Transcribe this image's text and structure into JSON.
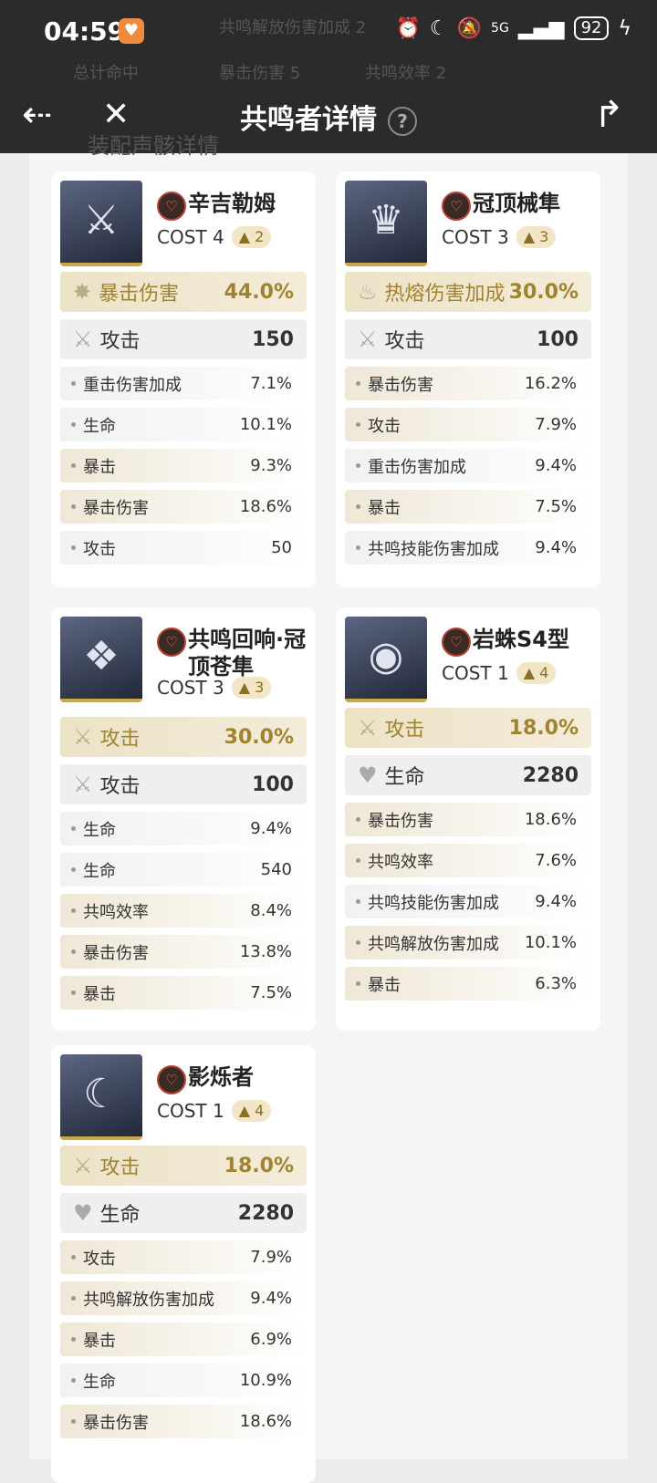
{
  "status": {
    "time": "04:59",
    "battery": "92",
    "network": "5G"
  },
  "nav": {
    "title": "共鸣者详情",
    "help": "?"
  },
  "background": {
    "line1": "共鸣解放伤害加成 2",
    "line2_a": "总计命中",
    "line2_b": "暴击伤害 5",
    "line2_c": "共鸣效率 2",
    "line3": "装配声骸详情"
  },
  "cards": [
    {
      "name": "辛吉勒姆",
      "cost": "COST 4",
      "tune": "2",
      "portrait_icon": "⚔",
      "main": {
        "label": "暴击伤害",
        "value": "44.0%",
        "icon": "✸"
      },
      "flat": {
        "label": "攻击",
        "value": "150",
        "icon": "⚔"
      },
      "subs": [
        {
          "label": "重击伤害加成",
          "value": "7.1%",
          "tone": "gray"
        },
        {
          "label": "生命",
          "value": "10.1%",
          "tone": "gray"
        },
        {
          "label": "暴击",
          "value": "9.3%",
          "tone": "gold"
        },
        {
          "label": "暴击伤害",
          "value": "18.6%",
          "tone": "gold"
        },
        {
          "label": "攻击",
          "value": "50",
          "tone": "gray"
        }
      ]
    },
    {
      "name": "冠顶械隼",
      "cost": "COST 3",
      "tune": "3",
      "portrait_icon": "♛",
      "main": {
        "label": "热熔伤害加成",
        "value": "30.0%",
        "icon": "♨"
      },
      "flat": {
        "label": "攻击",
        "value": "100",
        "icon": "⚔"
      },
      "subs": [
        {
          "label": "暴击伤害",
          "value": "16.2%",
          "tone": "gold"
        },
        {
          "label": "攻击",
          "value": "7.9%",
          "tone": "gold"
        },
        {
          "label": "重击伤害加成",
          "value": "9.4%",
          "tone": "gray"
        },
        {
          "label": "暴击",
          "value": "7.5%",
          "tone": "gold"
        },
        {
          "label": "共鸣技能伤害加成",
          "value": "9.4%",
          "tone": "gray"
        }
      ]
    },
    {
      "name": "共鸣回响·冠顶苍隼",
      "cost": "COST 3",
      "tune": "3",
      "portrait_icon": "❖",
      "main": {
        "label": "攻击",
        "value": "30.0%",
        "icon": "⚔"
      },
      "flat": {
        "label": "攻击",
        "value": "100",
        "icon": "⚔"
      },
      "subs": [
        {
          "label": "生命",
          "value": "9.4%",
          "tone": "gray"
        },
        {
          "label": "生命",
          "value": "540",
          "tone": "gray"
        },
        {
          "label": "共鸣效率",
          "value": "8.4%",
          "tone": "gold"
        },
        {
          "label": "暴击伤害",
          "value": "13.8%",
          "tone": "gold"
        },
        {
          "label": "暴击",
          "value": "7.5%",
          "tone": "gold"
        }
      ]
    },
    {
      "name": "岩蛛S4型",
      "cost": "COST 1",
      "tune": "4",
      "portrait_icon": "◉",
      "main": {
        "label": "攻击",
        "value": "18.0%",
        "icon": "⚔"
      },
      "flat": {
        "label": "生命",
        "value": "2280",
        "icon": "♥"
      },
      "subs": [
        {
          "label": "暴击伤害",
          "value": "18.6%",
          "tone": "gold"
        },
        {
          "label": "共鸣效率",
          "value": "7.6%",
          "tone": "gold"
        },
        {
          "label": "共鸣技能伤害加成",
          "value": "9.4%",
          "tone": "gray"
        },
        {
          "label": "共鸣解放伤害加成",
          "value": "10.1%",
          "tone": "gold"
        },
        {
          "label": "暴击",
          "value": "6.3%",
          "tone": "gold"
        }
      ]
    },
    {
      "name": "影烁者",
      "cost": "COST 1",
      "tune": "4",
      "portrait_icon": "☾",
      "main": {
        "label": "攻击",
        "value": "18.0%",
        "icon": "⚔"
      },
      "flat": {
        "label": "生命",
        "value": "2280",
        "icon": "♥"
      },
      "subs": [
        {
          "label": "攻击",
          "value": "7.9%",
          "tone": "gold"
        },
        {
          "label": "共鸣解放伤害加成",
          "value": "9.4%",
          "tone": "gold"
        },
        {
          "label": "暴击",
          "value": "6.9%",
          "tone": "gold"
        },
        {
          "label": "生命",
          "value": "10.9%",
          "tone": "gray"
        },
        {
          "label": "暴击伤害",
          "value": "18.6%",
          "tone": "gold"
        }
      ]
    }
  ]
}
